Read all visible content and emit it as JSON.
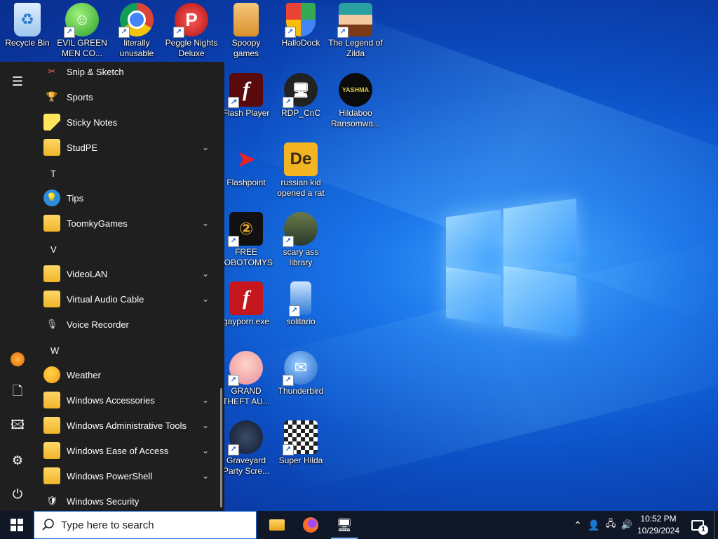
{
  "desktop": {
    "icons": [
      {
        "label": "Recycle Bin"
      },
      {
        "label": "EVIL GREEN MEN CO..."
      },
      {
        "label": "literally unusable"
      },
      {
        "label": "Peggle Nights Deluxe"
      },
      {
        "label": "Spoopy games"
      },
      {
        "label": "HalloDock"
      },
      {
        "label": "The Legend of Zilda"
      },
      {
        "label": "Flash Player"
      },
      {
        "label": "RDP_CnC"
      },
      {
        "label": "Hildaboo Ransomwa..."
      },
      {
        "label": "Flashpoint"
      },
      {
        "label": "russian kid opened a rat"
      },
      {
        "label": "FREE LOBOTOMYS"
      },
      {
        "label": "scary ass library"
      },
      {
        "label": "gayporn.exe"
      },
      {
        "label": "solitario"
      },
      {
        "label": "GRAND THEFT AU..."
      },
      {
        "label": "Thunderbird"
      },
      {
        "label": "Graveyard Party Scre..."
      },
      {
        "label": "Super Hilda"
      }
    ],
    "icon_texts": {
      "yashma": "YASHMA",
      "de": "De"
    }
  },
  "start_menu": {
    "items": [
      {
        "label": "Snip & Sketch"
      },
      {
        "label": "Sports"
      },
      {
        "label": "Sticky Notes"
      },
      {
        "label": "StudPE"
      },
      {
        "letter": "T"
      },
      {
        "label": "Tips"
      },
      {
        "label": "ToomkyGames"
      },
      {
        "letter": "V"
      },
      {
        "label": "VideoLAN"
      },
      {
        "label": "Virtual Audio Cable"
      },
      {
        "label": "Voice Recorder"
      },
      {
        "letter": "W"
      },
      {
        "label": "Weather"
      },
      {
        "label": "Windows Accessories"
      },
      {
        "label": "Windows Administrative Tools"
      },
      {
        "label": "Windows Ease of Access"
      },
      {
        "label": "Windows PowerShell"
      },
      {
        "label": "Windows Security"
      }
    ]
  },
  "taskbar": {
    "search_placeholder": "Type here to search",
    "clock_time": "10:52 PM",
    "clock_date": "10/29/2024",
    "notification_count": "1"
  },
  "colors": {
    "start_menu_bg": "#1f1f1f",
    "taskbar_bg": "#101828",
    "accent": "#1a6fd6"
  }
}
